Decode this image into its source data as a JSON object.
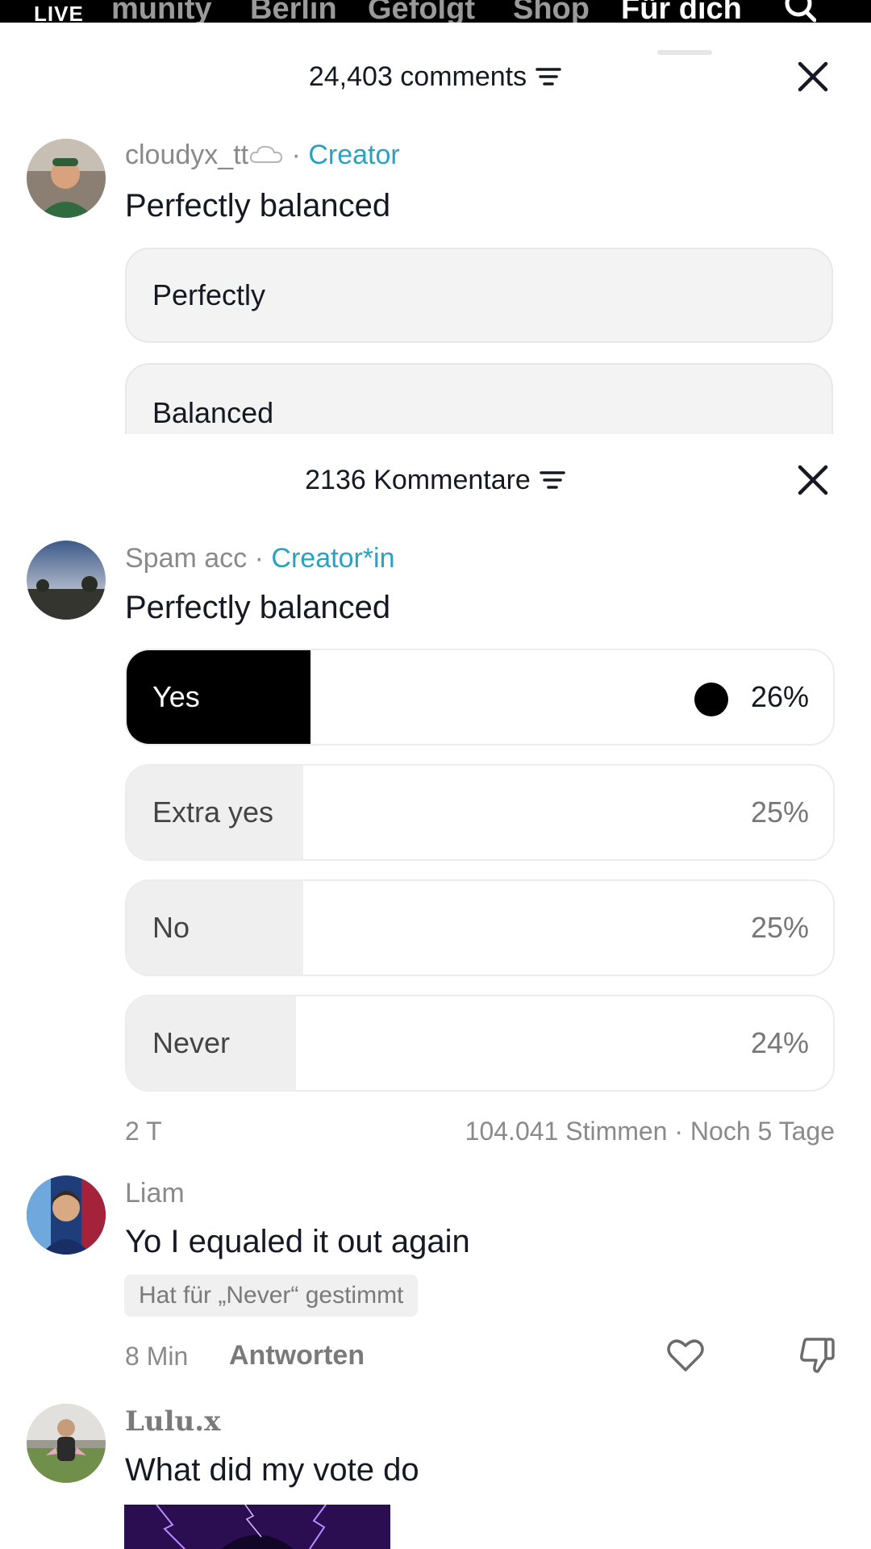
{
  "top_nav": {
    "live": "LIVE",
    "tabs": [
      "munity",
      "Berlin",
      "Gefolgt",
      "Shop",
      "Für dich"
    ]
  },
  "sheet1": {
    "count_label": "24,403 comments",
    "comment": {
      "username": "cloudyx_tt",
      "separator": "·",
      "badge": "Creator",
      "text": "Perfectly balanced",
      "options": [
        "Perfectly",
        "Balanced"
      ]
    }
  },
  "sheet2": {
    "count_label": "2136 Kommentare",
    "comment": {
      "username": "Spam acc",
      "separator": "·",
      "badge": "Creator*in",
      "text": "Perfectly balanced",
      "poll": [
        {
          "label": "Yes",
          "percent": "26%",
          "value": 26,
          "selected": true
        },
        {
          "label": "Extra yes",
          "percent": "25%",
          "value": 25,
          "selected": false
        },
        {
          "label": "No",
          "percent": "25%",
          "value": 25,
          "selected": false
        },
        {
          "label": "Never",
          "percent": "24%",
          "value": 24,
          "selected": false
        }
      ],
      "age": "2 T",
      "votes_info": "104.041 Stimmen · Noch 5 Tage"
    },
    "replies": [
      {
        "username": "Liam",
        "text": "Yo I equaled it out again",
        "voted": "Hat für „Never“ gestimmt",
        "time": "8 Min",
        "reply_label": "Antworten"
      },
      {
        "username": "Lulu.x",
        "text": "What did my vote do"
      }
    ]
  },
  "colors": {
    "creator_badge": "#27a3c0",
    "selected_fill": "#000000",
    "option_fill": "#efefef"
  }
}
